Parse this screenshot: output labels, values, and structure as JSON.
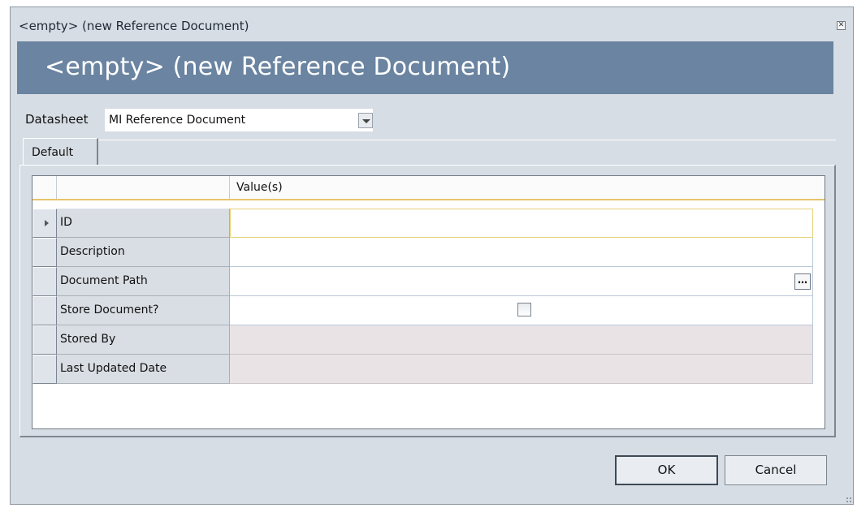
{
  "window": {
    "title": "<empty> (new Reference Document)"
  },
  "header": {
    "title": "<empty> (new Reference Document)"
  },
  "datasheet": {
    "label": "Datasheet",
    "selected": "MI Reference Document"
  },
  "tabs": [
    {
      "label": "Default"
    }
  ],
  "grid": {
    "value_header": "Value(s)",
    "rows": [
      {
        "field": "ID",
        "value": ""
      },
      {
        "field": "Description",
        "value": ""
      },
      {
        "field": "Document Path",
        "value": ""
      },
      {
        "field": "Store Document?",
        "checked": false
      },
      {
        "field": "Stored By",
        "value": ""
      },
      {
        "field": "Last Updated Date",
        "value": ""
      }
    ]
  },
  "buttons": {
    "ok": "OK",
    "cancel": "Cancel"
  },
  "colors": {
    "banner": "#6a84a1",
    "window_bg": "#d7dde4",
    "readonly_cell": "#e9e3e5"
  }
}
